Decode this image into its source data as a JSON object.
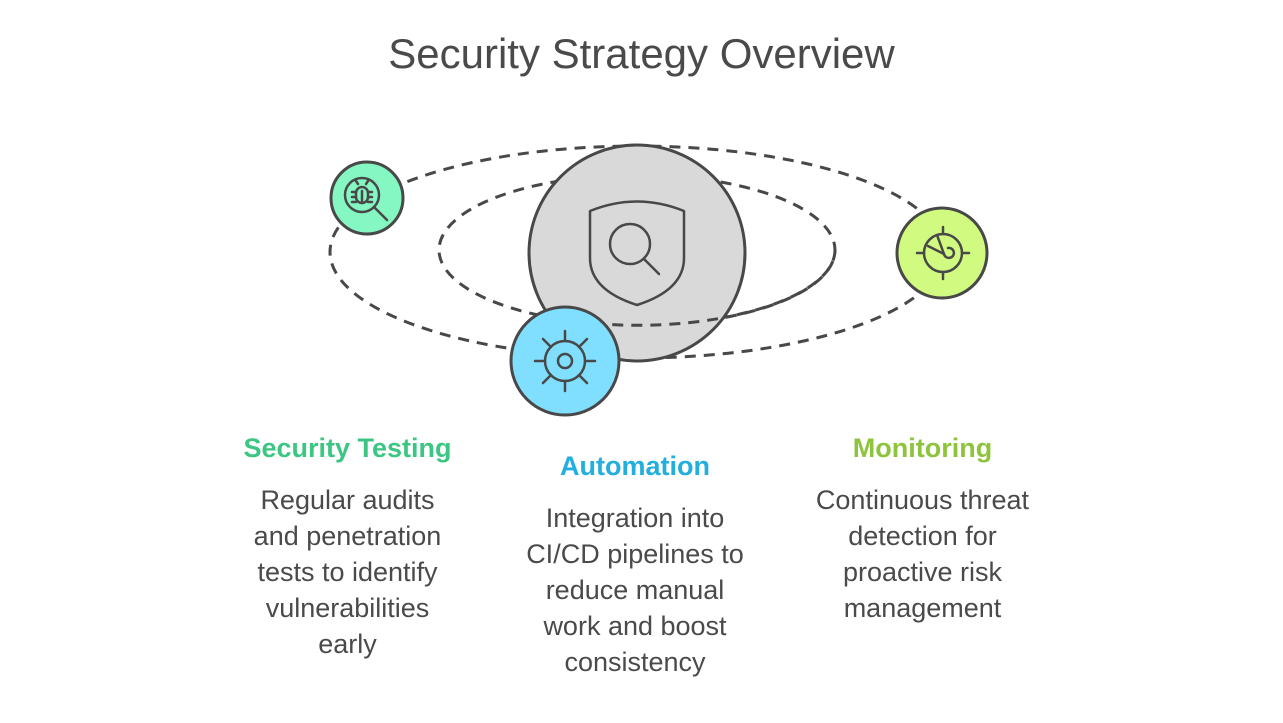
{
  "title": "Security Strategy Overview",
  "center": {
    "icon": "shield-search-icon",
    "fill": "#d9d9d9"
  },
  "items": [
    {
      "heading": "Security Testing",
      "description": [
        "Regular audits",
        "and penetration",
        "tests to identify",
        "vulnerabilities",
        "early"
      ],
      "icon": "bug-search-icon",
      "heading_color": "#3cc684",
      "fill": "#85f7c3"
    },
    {
      "heading": "Automation",
      "description": [
        "Integration into",
        "CI/CD pipelines to",
        "reduce manual",
        "work and boost",
        "consistency"
      ],
      "icon": "gear-icon",
      "heading_color": "#22aede",
      "fill": "#80dfff"
    },
    {
      "heading": "Monitoring",
      "description": [
        "Continuous threat",
        "detection for",
        "proactive risk",
        "management"
      ],
      "icon": "radar-icon",
      "heading_color": "#8dc43c",
      "fill": "#d1fa80"
    }
  ],
  "stroke_color": "#484848"
}
